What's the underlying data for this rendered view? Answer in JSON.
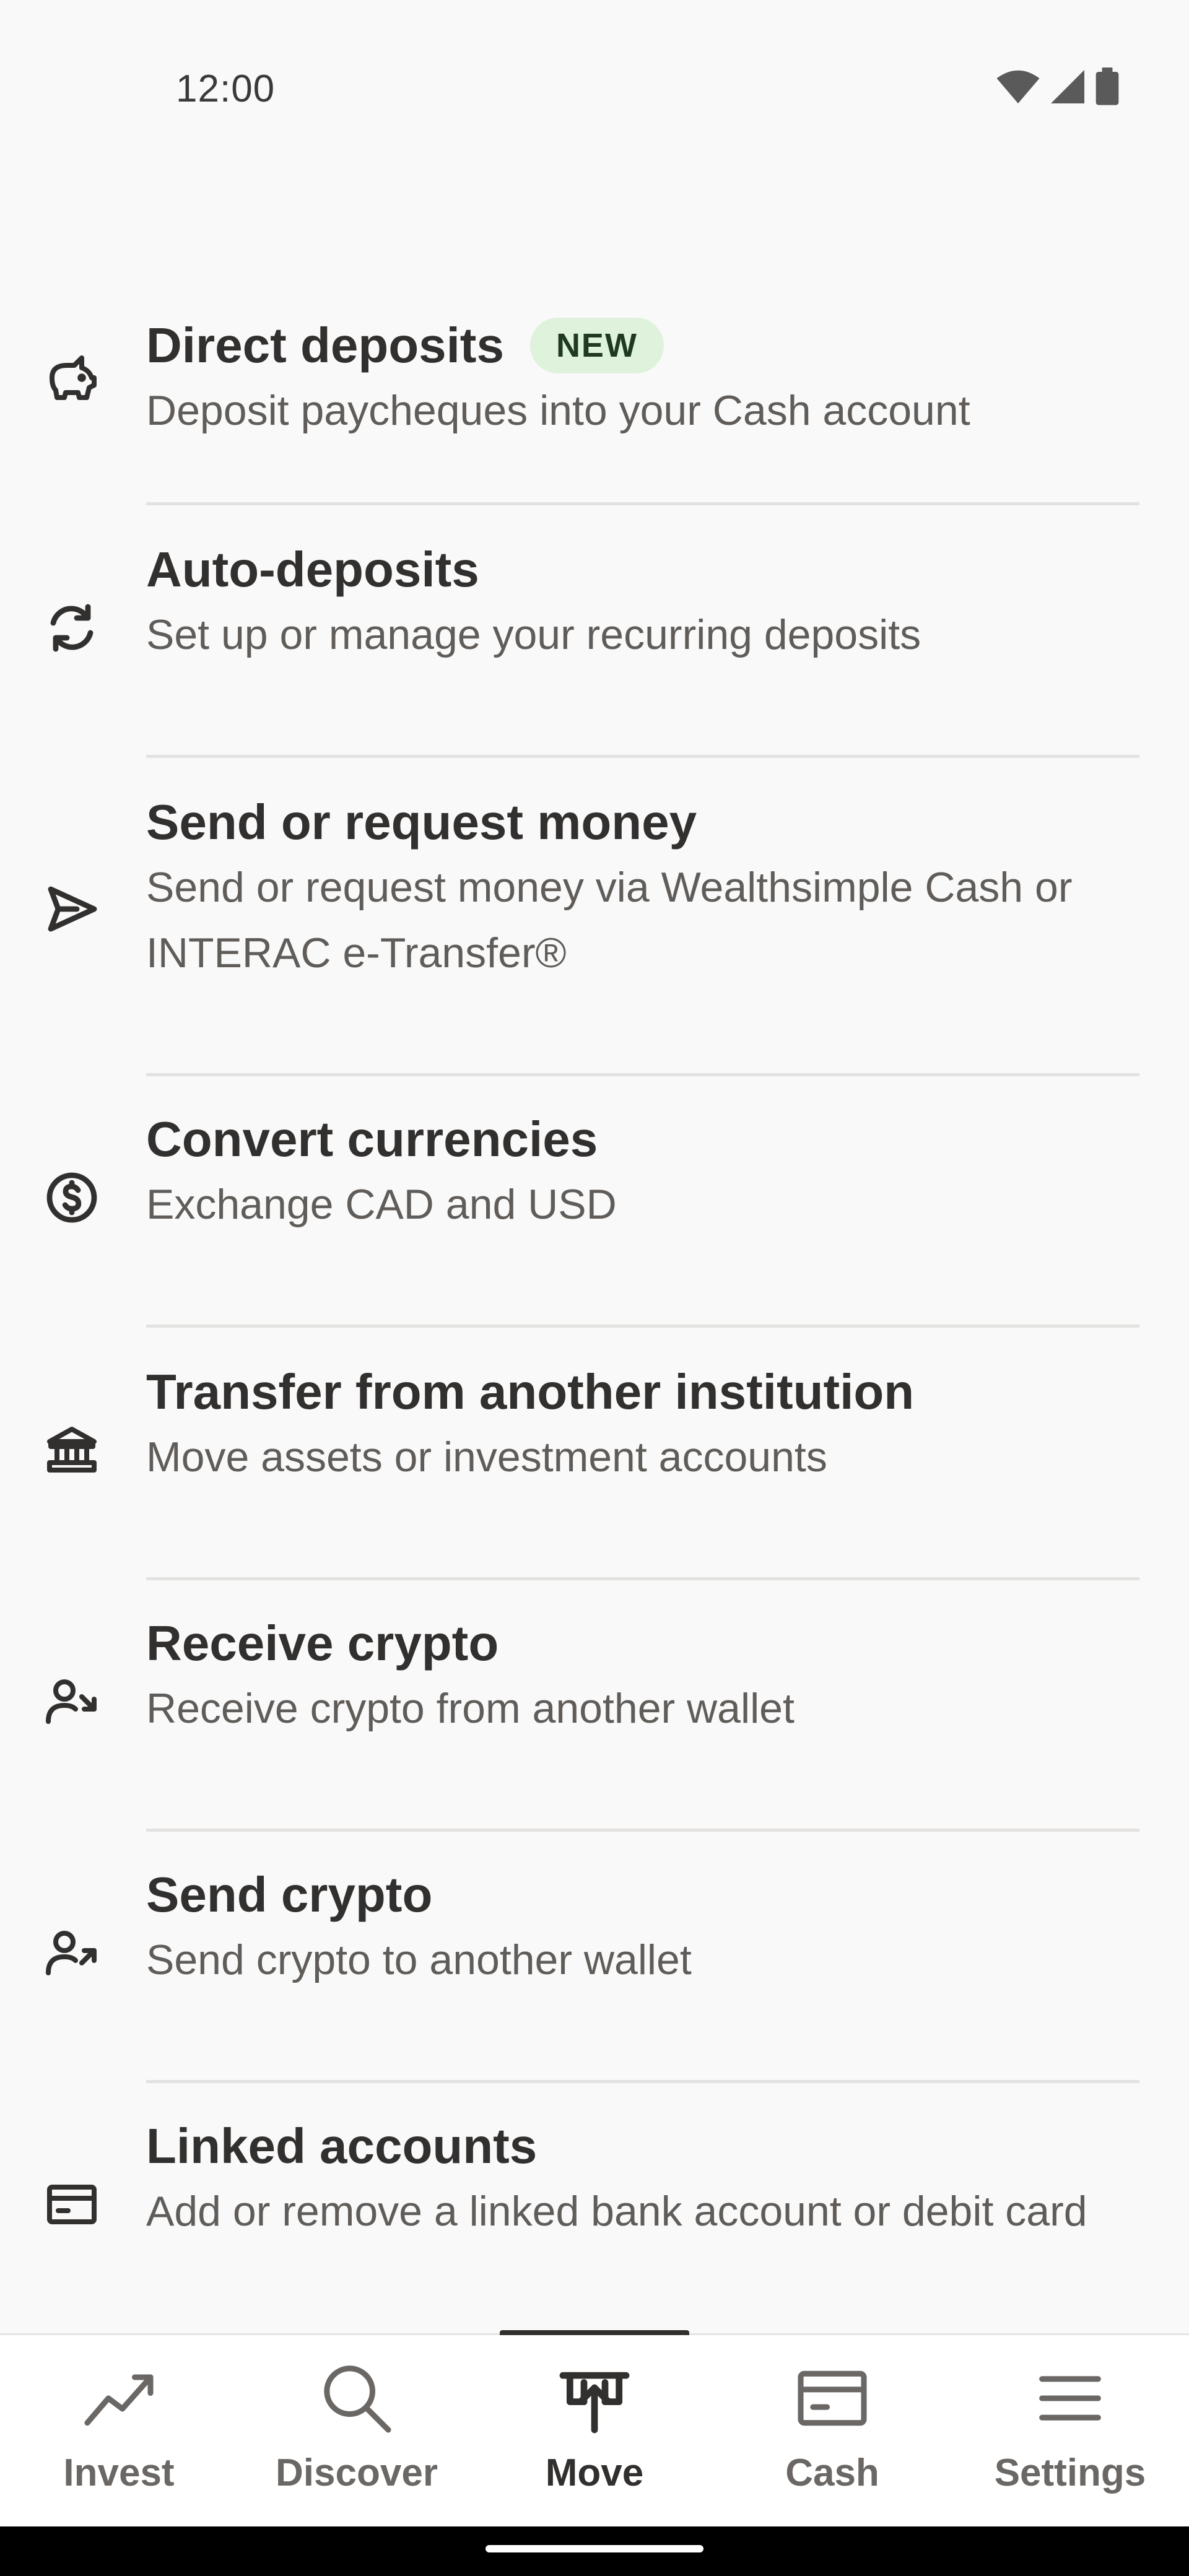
{
  "status_bar": {
    "time": "12:00",
    "icons": [
      "wifi-icon",
      "cellular-signal-icon",
      "battery-icon"
    ]
  },
  "move_menu": {
    "items": [
      {
        "icon": "piggy-bank-icon",
        "title": "Direct deposits",
        "badge": "NEW",
        "subtitle": "Deposit paycheques into your Cash account"
      },
      {
        "icon": "recurring-arrows-icon",
        "title": "Auto-deposits",
        "subtitle": "Set up or manage your recurring deposits"
      },
      {
        "icon": "send-arrow-icon",
        "title": "Send or request money",
        "subtitle": "Send or request money via Wealthsimple Cash or INTERAC e-Transfer®"
      },
      {
        "icon": "dollar-coin-icon",
        "title": "Convert currencies",
        "subtitle": "Exchange CAD and USD"
      },
      {
        "icon": "bank-building-icon",
        "title": "Transfer from another institution",
        "subtitle": "Move assets or investment accounts"
      },
      {
        "icon": "person-arrow-in-icon",
        "title": "Receive crypto",
        "subtitle": "Receive crypto from another wallet"
      },
      {
        "icon": "person-arrow-out-icon",
        "title": "Send crypto",
        "subtitle": "Send crypto to another wallet"
      },
      {
        "icon": "card-icon",
        "title": "Linked accounts",
        "subtitle": "Add or remove a linked bank account or debit card"
      }
    ]
  },
  "bottom_nav": {
    "active": "Move",
    "tabs": [
      {
        "label": "Invest",
        "icon": "trend-line-icon"
      },
      {
        "label": "Discover",
        "icon": "search-icon"
      },
      {
        "label": "Move",
        "icon": "move-transfer-icon"
      },
      {
        "label": "Cash",
        "icon": "card-icon"
      },
      {
        "label": "Settings",
        "icon": "menu-icon"
      }
    ]
  },
  "colors": {
    "background": "#f9f9f9",
    "text_primary": "#32302f",
    "text_secondary": "#5f5c59",
    "badge_bg": "#dff2dc",
    "divider": "#e4e2e0"
  }
}
